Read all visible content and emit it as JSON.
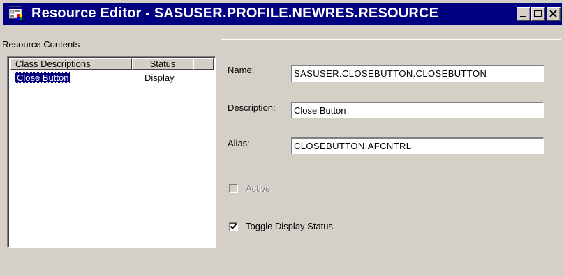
{
  "window": {
    "title": "Resource Editor - SASUSER.PROFILE.NEWRES.RESOURCE",
    "icon": "resource-editor-app-icon",
    "controls": {
      "minimize": "minimize-icon",
      "maximize": "maximize-icon",
      "close": "close-icon"
    }
  },
  "resource_contents": {
    "label": "Resource Contents",
    "columns": [
      "Class Descriptions",
      "Status",
      ""
    ],
    "rows": [
      {
        "description": "Close Button",
        "status": "Display",
        "selected": true
      }
    ]
  },
  "details": {
    "name_label": "Name:",
    "name_value": "SASUSER.CLOSEBUTTON.CLOSEBUTTON",
    "description_label": "Description:",
    "description_value": "Close Button",
    "alias_label": "Alias:",
    "alias_value": "CLOSEBUTTON.AFCNTRL",
    "active_label": "Active",
    "active_checked": false,
    "active_enabled": false,
    "toggle_label": "Toggle Display Status",
    "toggle_checked": true
  },
  "colors": {
    "titlebar": "#000080",
    "face": "#d4d0c8",
    "selection": "#000080"
  }
}
